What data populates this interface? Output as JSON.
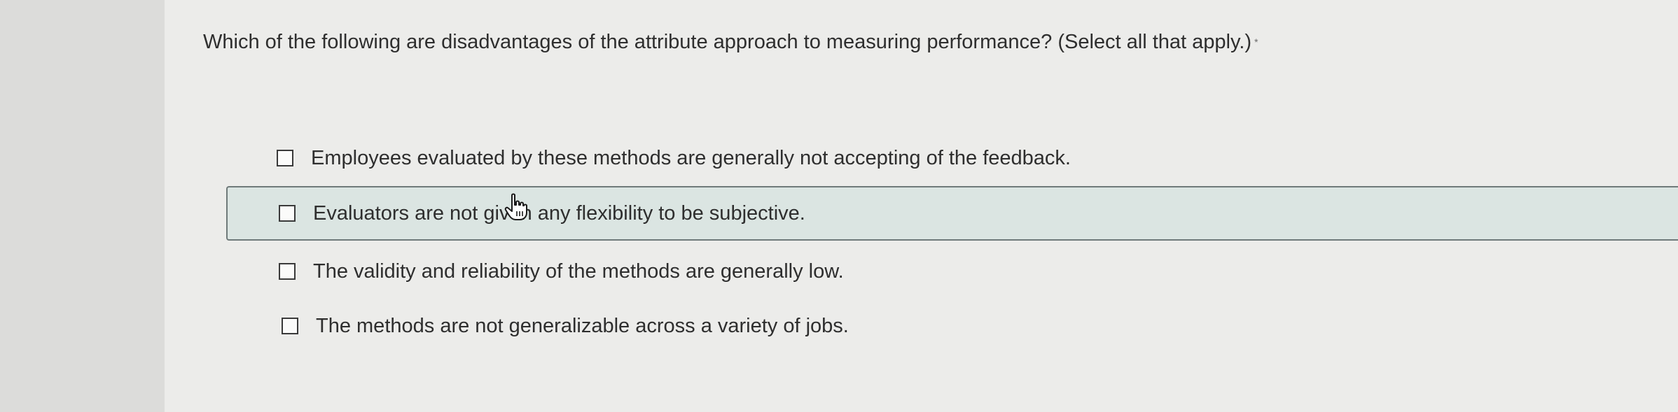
{
  "question": {
    "text": "Which of the following are disadvantages of the attribute approach to measuring performance? (Select all that apply.)",
    "required_marker": "*"
  },
  "options": [
    {
      "label": "Employees evaluated by these methods are generally not accepting of the feedback.",
      "checked": false
    },
    {
      "label": "Evaluators are not given any flexibility to be subjective.",
      "checked": false,
      "hovered": true
    },
    {
      "label": "The validity and reliability of the methods are generally low.",
      "checked": false
    },
    {
      "label": "The methods are not generalizable across a variety of jobs.",
      "checked": false
    }
  ],
  "cursor": {
    "icon": "hand-pointer-icon"
  }
}
